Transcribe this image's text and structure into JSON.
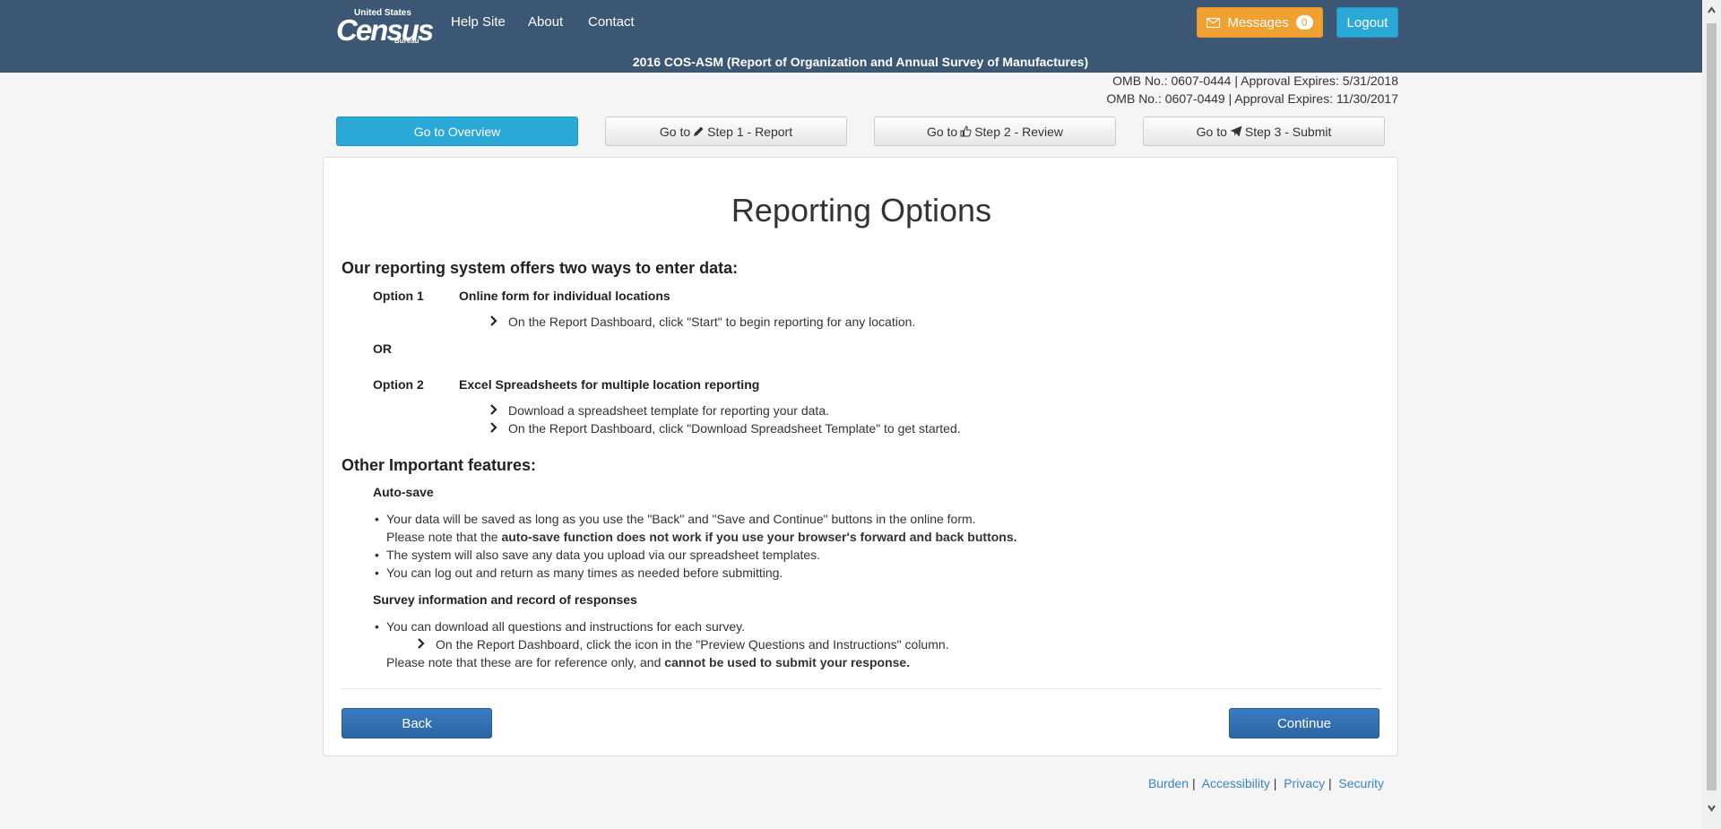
{
  "header": {
    "logo": {
      "line1": "United States",
      "line2": "Census",
      "line3": "Bureau"
    },
    "nav": [
      "Help Site",
      "About",
      "Contact"
    ],
    "messages_label": "Messages",
    "messages_count": "0",
    "logout_label": "Logout",
    "survey_title": "2016 COS-ASM (Report of Organization and Annual Survey of Manufactures)",
    "omb": [
      "OMB No.: 0607-0444  |  Approval Expires: 5/31/2018",
      "OMB No.: 0607-0449  |  Approval Expires: 11/30/2017"
    ]
  },
  "steps": {
    "overview": "Go to Overview",
    "goto": "Go to",
    "step1": "Step 1 - Report",
    "step2": "Step 2 - Review",
    "step3": "Step 3 - Submit"
  },
  "main": {
    "title": "Reporting Options",
    "intro_heading": "Our reporting system offers two ways to enter data:",
    "option1": {
      "label": "Option 1",
      "title": "Online form for individual locations",
      "items": [
        "On the Report Dashboard, click \"Start\" to begin reporting for any location."
      ]
    },
    "or": "OR",
    "option2": {
      "label": "Option 2",
      "title": "Excel Spreadsheets for multiple location reporting",
      "items": [
        "Download a spreadsheet template for reporting your data.",
        "On the Report Dashboard, click \"Download Spreadsheet Template\" to get started."
      ]
    },
    "features_heading": "Other Important features:",
    "autosave": {
      "title": "Auto-save",
      "b1": "Your data will be saved as long as you use the \"Back\" and \"Save and Continue\" buttons in the online form.",
      "b1_note_prefix": "Please note that the ",
      "b1_note_bold": "auto-save function does not work if you use your browser's forward and back buttons.",
      "b2": "The system will also save any data you upload via our spreadsheet templates.",
      "b3": "You can log out and return as many times as needed before submitting."
    },
    "survey_info": {
      "title": "Survey information and record of responses",
      "b1": "You can download all questions and instructions for each survey.",
      "sub": "On the Report Dashboard, click the icon in the \"Preview Questions and Instructions\" column.",
      "note_prefix": "Please note that these are for reference only, and ",
      "note_bold": "cannot be used to submit your response."
    },
    "back_label": "Back",
    "continue_label": "Continue"
  },
  "footer": {
    "links": [
      "Burden",
      "Accessibility",
      "Privacy",
      "Security"
    ]
  },
  "colors": {
    "header_bg": "#3c5774",
    "messages_orange": "#f0a132",
    "accent_cyan": "#2aa8d6",
    "primary_blue": "#2b65a3",
    "link_blue": "#3a86c8"
  }
}
